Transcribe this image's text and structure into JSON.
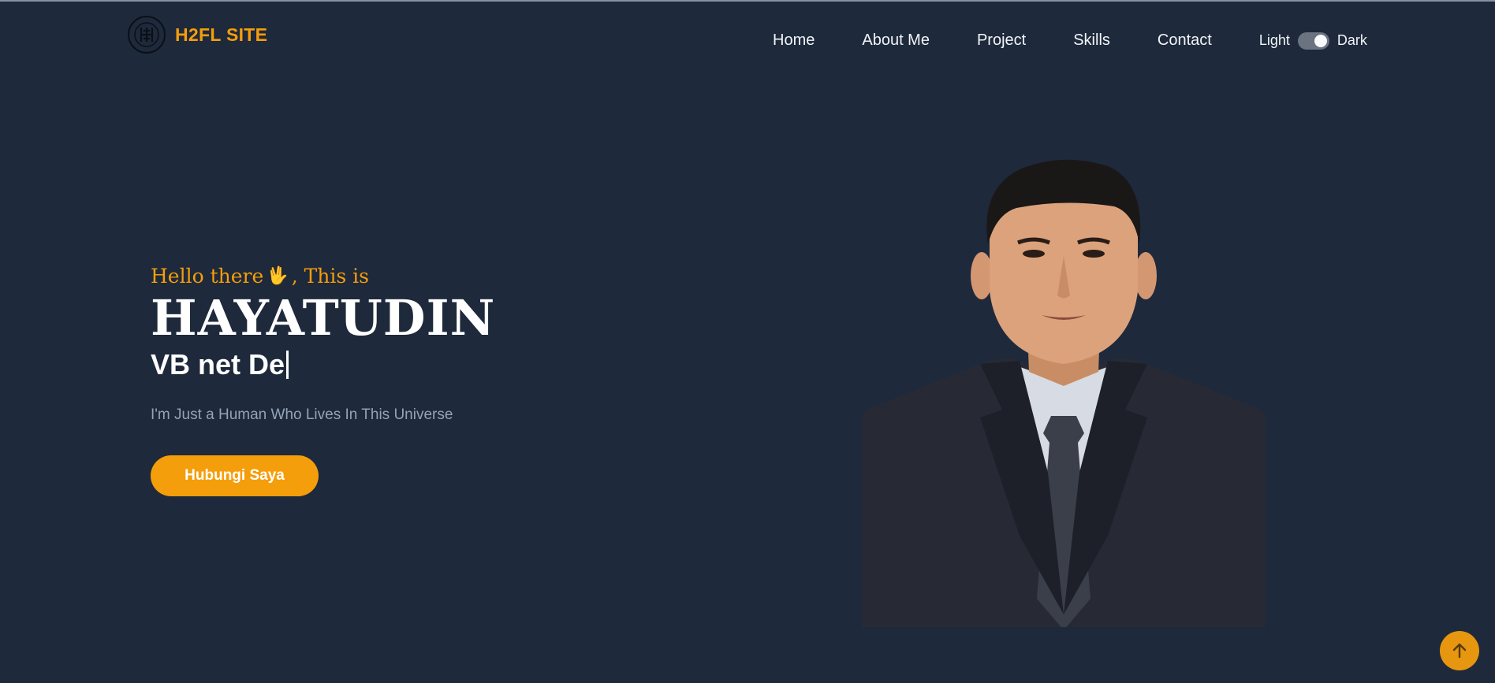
{
  "brand": {
    "name": "H2FL SITE",
    "logo_icon": "h2fl-logo-icon"
  },
  "nav": {
    "items": [
      {
        "label": "Home"
      },
      {
        "label": "About Me"
      },
      {
        "label": "Project"
      },
      {
        "label": "Skills"
      },
      {
        "label": "Contact"
      }
    ],
    "theme": {
      "light_label": "Light",
      "dark_label": "Dark",
      "state": "dark"
    }
  },
  "hero": {
    "greeting": "Hello there",
    "greeting_emoji": "🖖",
    "greeting_suffix": ", This is",
    "name": "HAYATUDIN",
    "typed_role": "VB net De",
    "tagline": "I'm Just a Human Who Lives In This Universe",
    "cta_label": "Hubungi Saya"
  },
  "scroll_top": {
    "icon": "arrow-up-icon"
  },
  "colors": {
    "background": "#1e293b",
    "accent": "#f59e0b",
    "text": "#ffffff",
    "muted": "#94a3b8"
  }
}
